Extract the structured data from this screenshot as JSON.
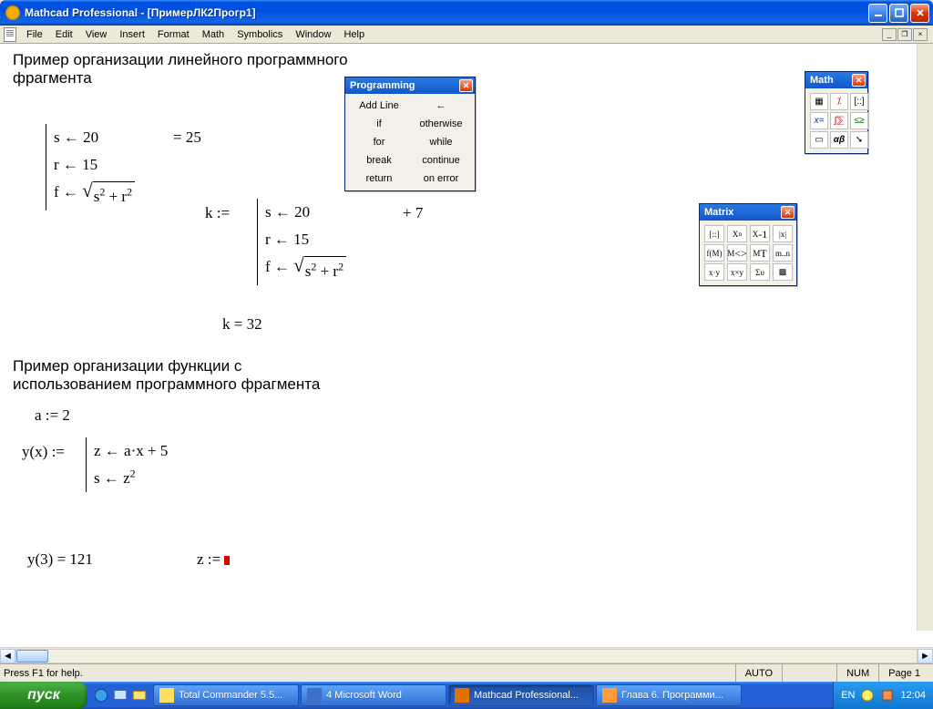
{
  "window": {
    "title": "Mathcad Professional - [ПримерЛК2Прогр1]"
  },
  "menu": {
    "file": "File",
    "edit": "Edit",
    "view": "View",
    "insert": "Insert",
    "format": "Format",
    "math": "Math",
    "symbolics": "Symbolics",
    "window": "Window",
    "help": "Help"
  },
  "doc": {
    "heading1": "Пример организации линейного программного\nфрагмента",
    "block1": {
      "l1": "s ← 20",
      "l2": "r ← 15",
      "l3_pre": "f ← ",
      "sqrt_expr": "s",
      "sqrt_expr2": " + r",
      "eq": "= 25"
    },
    "block2": {
      "kdef": "k :=",
      "l1": "s ← 20",
      "l2": "r ← 15",
      "l3_pre": "f ← ",
      "plus7": "+ 7",
      "kres": "k = 32"
    },
    "heading2": "Пример организации функции с\nиспользованием программного фрагмента",
    "a_assign": "a := 2",
    "ydef": "y(x) :=",
    "yl1": "z ← a·x + 5",
    "yl2_pre": "s ← z",
    "yres": "y(3) = 121",
    "zdef": "z := "
  },
  "programming_palette": {
    "title": "Programming",
    "items": [
      "Add Line",
      "←",
      "if",
      "otherwise",
      "for",
      "while",
      "break",
      "continue",
      "return",
      "on error"
    ]
  },
  "math_palette": {
    "title": "Math"
  },
  "matrix_palette": {
    "title": "Matrix"
  },
  "statusbar": {
    "help": "Press F1 for help.",
    "auto": "AUTO",
    "num": "NUM",
    "page": "Page 1"
  },
  "taskbar": {
    "start": "пуск",
    "tasks": [
      {
        "label": "Total Commander 5.5...",
        "icon": "#ffdf5e"
      },
      {
        "label": "4 Microsoft Word",
        "icon": "#3b6fc8"
      },
      {
        "label": "Mathcad Professional...",
        "icon": "#e07000",
        "active": true
      },
      {
        "label": "Глава 6. Программи...",
        "icon": "#ff9a3d"
      }
    ],
    "lang": "EN",
    "clock": "12:04"
  }
}
